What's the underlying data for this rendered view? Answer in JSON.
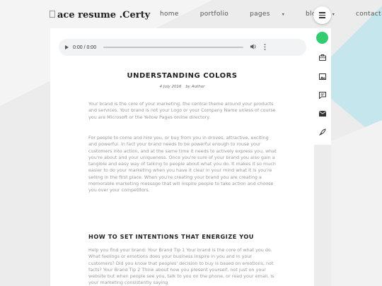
{
  "logo": {
    "alt_text": "ace resume .Certy"
  },
  "nav": {
    "items": [
      {
        "label": "home",
        "has_caret": false
      },
      {
        "label": "portfolio",
        "has_caret": false
      },
      {
        "label": "pages",
        "has_caret": true
      },
      {
        "label": "blog",
        "has_caret": true
      },
      {
        "label": "contact",
        "has_caret": false
      }
    ],
    "caret_glyph": "▾"
  },
  "menu_button": {
    "icon": "hamburger-icon"
  },
  "audio_player": {
    "time": "0:00 / 0:00"
  },
  "article": {
    "title": "UNDERSTANDING COLORS",
    "date": "4 July 2016",
    "author": "by Author",
    "paragraph1": "Your brand is the core of your marketing, the central theme around your products and services. Your brand is not your Logo or your Company Name unless of course you are Microsoft or the Yellow Pages online directory.",
    "paragraph2": "For people to come and hire you, or buy from you in droves, attractive, exciting and powerful. In fact your brand needs to be powerful enough to rouse your customers into action, and at the same time it needs to actively express you, what you're about and your uniqueness. Once you're sure of your brand you also gain a tangible and easy way of talking to people about what you do. It makes it so much easier to do your marketing when you have it clear in your mind what it is you're selling in the first place. When you're creating your brand you are creating a memorable marketing message that will inspire people to take action and choose you over your competitors.",
    "subheading": "HOW TO SET INTENTIONS THAT ENERGIZE YOU",
    "paragraph3": "Help you find your brand: Your Brand Tip 1 Your brand is the core of what you do. What feelings or emotions does your business inspire in you and in your customers? Did you know that peoples' decision to buy is based on emotions, not facts? Your Brand Tip 2 Think about how you present yourself, not just on your website but when people see you, talk to you on the phone, or read your email. Is your marketing consistently saying"
  },
  "sidebar": {
    "icons": [
      "status-dot-icon",
      "briefcase-icon",
      "image-icon",
      "chat-icon",
      "envelope-icon",
      "pen-icon"
    ],
    "accent_color": "#33cc70"
  },
  "colors": {
    "background": "#ececec",
    "teal_shape": "#c5e6ec",
    "card": "#ffffff",
    "text_body": "#9a9a9a",
    "text_heading": "#222222"
  }
}
